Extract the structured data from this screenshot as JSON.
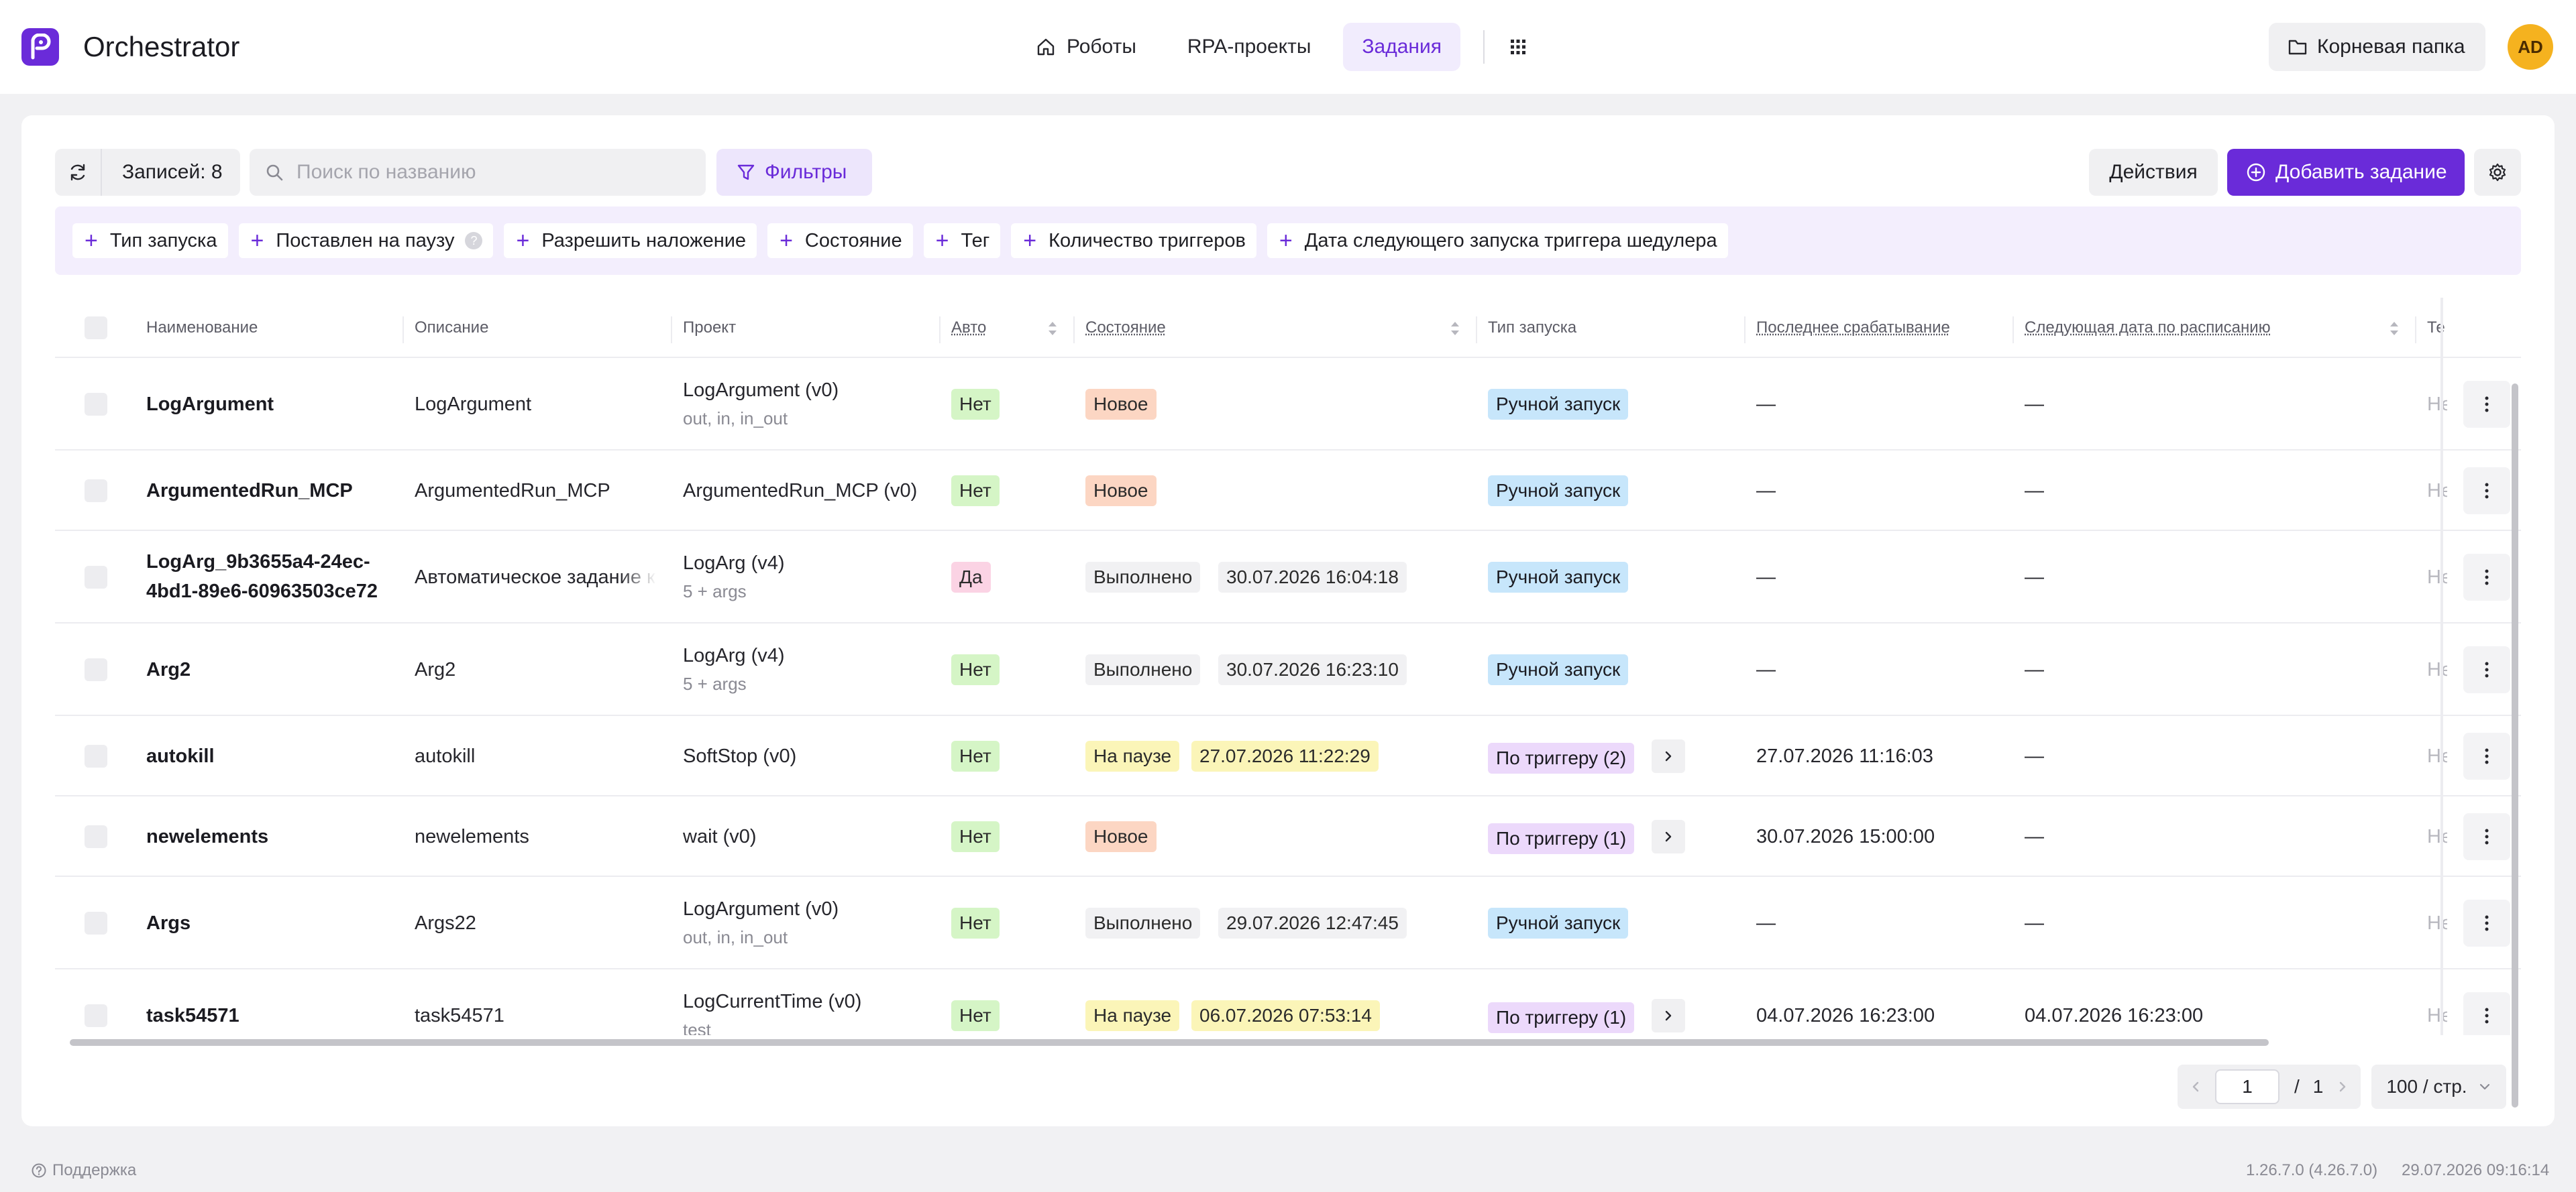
{
  "app": {
    "title": "Orchestrator"
  },
  "nav": {
    "robots": "Роботы",
    "rpa": "RPA-проекты",
    "tasks": "Задания"
  },
  "folder": {
    "label": "Корневая папка"
  },
  "user": {
    "initials": "AD"
  },
  "toolbar": {
    "records": "Записей: 8",
    "search_placeholder": "Поиск по названию",
    "filters": "Фильтры",
    "actions": "Действия",
    "add": "Добавить задание"
  },
  "chips": [
    "Тип запуска",
    "Поставлен на паузу",
    "Разрешить наложение",
    "Состояние",
    "Тег",
    "Количество триггеров",
    "Дата следующего запуска триггера шедулера"
  ],
  "columns": {
    "name": "Наименование",
    "description": "Описание",
    "project": "Проект",
    "auto": "Авто",
    "state": "Состояние",
    "launch": "Тип запуска",
    "last": "Последнее срабатывание",
    "next": "Следующая дата по расписанию",
    "tag": "Тег"
  },
  "rows": [
    {
      "name": "LogArgument",
      "desc": "LogArgument",
      "project": "LogArgument (v0)",
      "args": "out, in, in_out",
      "auto": "Нет",
      "state": "Новое",
      "state_date": "",
      "launch": "Ручной запуск",
      "last": "—",
      "next": "—",
      "tag": "Нет"
    },
    {
      "name": "ArgumentedRun_MCP",
      "desc": "ArgumentedRun_MCP",
      "project": "ArgumentedRun_MCP (v0)",
      "args": "",
      "auto": "Нет",
      "state": "Новое",
      "state_date": "",
      "launch": "Ручной запуск",
      "last": "—",
      "next": "—",
      "tag": "Нет"
    },
    {
      "name": "LogArg_9b3655a4-24ec-",
      "name2": "4bd1-89e6-60963503ce72",
      "desc": "Автоматическое задание к",
      "project": "LogArg (v4)",
      "args": "5 + args",
      "auto": "Да",
      "state": "Выполнено",
      "state_date": "30.07.2026 16:04:18",
      "launch": "Ручной запуск",
      "last": "—",
      "next": "—",
      "tag": "Нет"
    },
    {
      "name": "Arg2",
      "desc": "Arg2",
      "project": "LogArg (v4)",
      "args": "5 + args",
      "auto": "Нет",
      "state": "Выполнено",
      "state_date": "30.07.2026 16:23:10",
      "launch": "Ручной запуск",
      "last": "—",
      "next": "—",
      "tag": "Нет"
    },
    {
      "name": "autokill",
      "desc": "autokill",
      "project": "SoftStop (v0)",
      "args": "",
      "auto": "Нет",
      "state": "На паузе",
      "state_date": "27.07.2026 11:22:29",
      "launch": "По триггеру (2)",
      "last": "27.07.2026 11:16:03",
      "next": "—",
      "tag": "Нет"
    },
    {
      "name": "newelements",
      "desc": "newelements",
      "project": "wait (v0)",
      "args": "",
      "auto": "Нет",
      "state": "Новое",
      "state_date": "",
      "launch": "По триггеру (1)",
      "last": "30.07.2026 15:00:00",
      "next": "—",
      "tag": "Нет"
    },
    {
      "name": "Args",
      "desc": "Args22",
      "project": "LogArgument (v0)",
      "args": "out, in, in_out",
      "auto": "Нет",
      "state": "Выполнено",
      "state_date": "29.07.2026 12:47:45",
      "launch": "Ручной запуск",
      "last": "—",
      "next": "—",
      "tag": "Нет"
    },
    {
      "name": "task54571",
      "desc": "task54571",
      "project": "LogCurrentTime (v0)",
      "args": "test",
      "auto": "Нет",
      "state": "На паузе",
      "state_date": "06.07.2026 07:53:14",
      "launch": "По триггеру (1)",
      "last": "04.07.2026 16:23:00",
      "next": "04.07.2026 16:23:00",
      "tag": "Нет"
    }
  ],
  "pagination": {
    "page": "1",
    "sep": "/",
    "total": "1",
    "per_page": "100 / стр."
  },
  "footer": {
    "support": "Поддержка",
    "version": "1.26.7.0 (4.26.7.0)",
    "datetime": "29.07.2026 09:16:14"
  },
  "colors": {
    "accent": "#6a2bd9",
    "avatar": "#f5b21f"
  }
}
